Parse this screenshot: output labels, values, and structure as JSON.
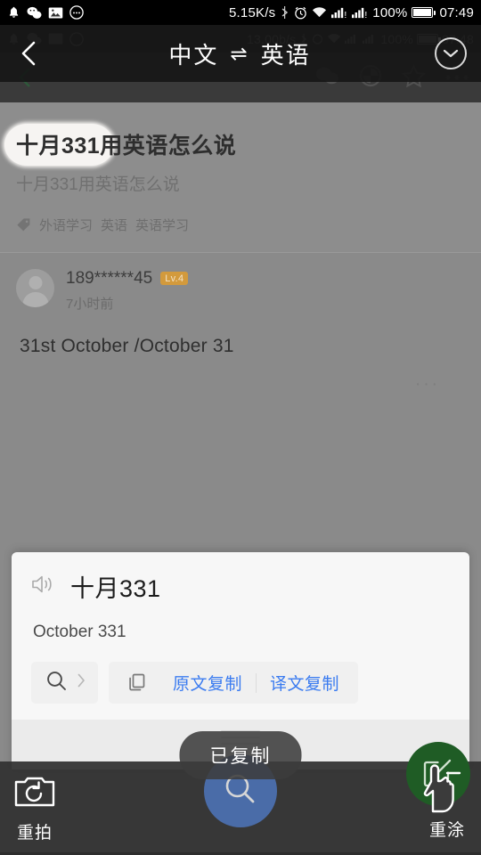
{
  "status_bar": {
    "notification_icons": [
      "bell-icon",
      "wechat-icon",
      "gallery-icon",
      "chat-bubble-icon"
    ],
    "network_speed": "5.15K/s",
    "system_icons": [
      "bluetooth-icon",
      "alarm-icon",
      "wifi-icon",
      "signal-1-icon",
      "signal-2-icon"
    ],
    "battery_percent": "100%",
    "time": "07:49"
  },
  "background_status_bar": {
    "network_speed": "13.00b/s",
    "battery_percent": "100%",
    "time": "07:48"
  },
  "translation_bar": {
    "back_icon": "back-chevron-icon",
    "source_language": "中文",
    "swap_symbol": "⇌",
    "target_language": "英语",
    "collapse_icon": "chevron-down-circle-icon"
  },
  "background_app": {
    "toolbar_icons": [
      "comment-icon",
      "share-icon",
      "star-icon",
      "overflow-menu-icon"
    ],
    "question": {
      "title_highlighted": "十月331",
      "title_rest": "用英语怎么说",
      "subtitle": "十月331用英语怎么说",
      "tag_icon": "tag-icon",
      "tags": [
        "外语学习",
        "英语",
        "英语学习"
      ]
    },
    "answer": {
      "avatar": "user-avatar",
      "username": "189******45",
      "level_badge": "Lv.4",
      "timestamp": "7小时前",
      "body": "31st October /October 31",
      "more_label": "···"
    }
  },
  "panel": {
    "speaker_icon": "speaker-icon",
    "source_text": "十月331",
    "translated_text": "October 331",
    "search_group": {
      "search_icon": "search-icon",
      "chevron_icon": "chevron-right-icon"
    },
    "copy_group": {
      "copy_icon": "copy-icon",
      "copy_source_label": "原文复制",
      "copy_translation_label": "译文复制"
    },
    "drag_handle": "drag-handle"
  },
  "toast": {
    "message": "已复制"
  },
  "bottom_bar": {
    "retake": {
      "icon": "camera-retake-icon",
      "label": "重拍"
    },
    "search_fab": {
      "icon": "search-icon"
    },
    "repaint": {
      "icon": "edit-pen-icon",
      "label": "重涂",
      "cursor": "hand-pointer-icon"
    }
  },
  "colors": {
    "accent_blue": "#3a7bf0",
    "fab_blue": "#4a6ca8",
    "repaint_green": "#1f5c25",
    "level_badge": "#d39a3c"
  }
}
